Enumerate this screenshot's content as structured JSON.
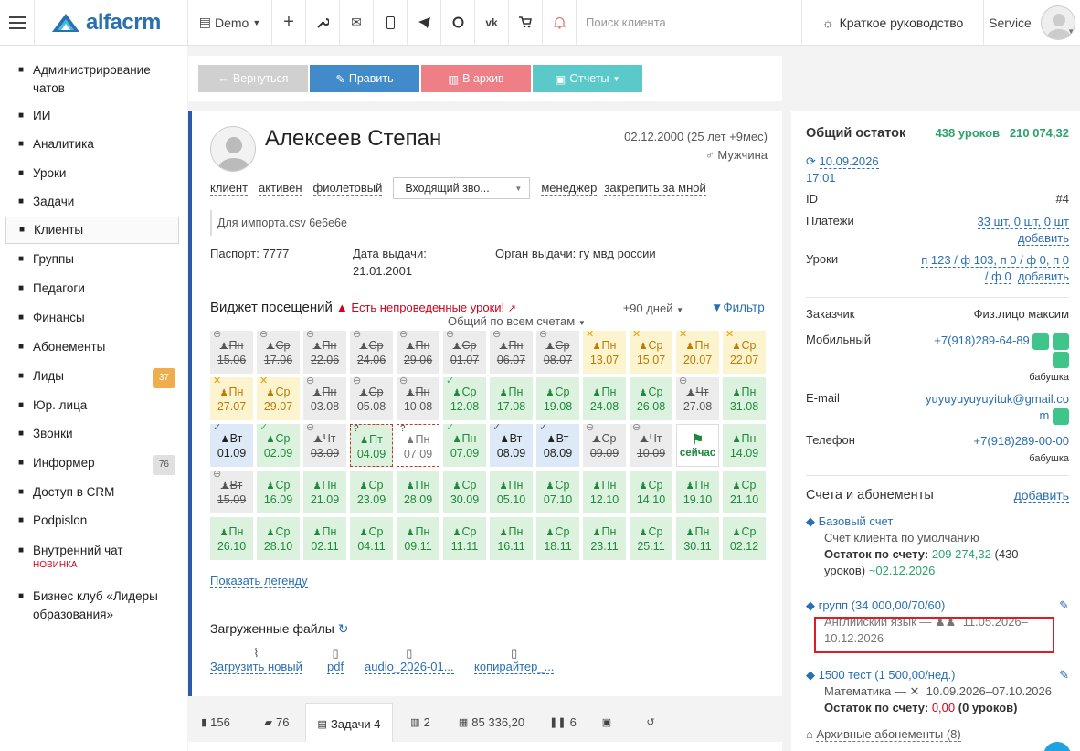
{
  "topbar": {
    "logo_text": "alfacrm",
    "demo_label": "Demo",
    "search_placeholder": "Поиск клиента",
    "guide_label": "Краткое руководство",
    "user_label": "Service",
    "icons": [
      "plus-icon",
      "wrench-icon",
      "envelope-icon",
      "mobile-icon",
      "telegram-icon",
      "whatsapp-icon",
      "vk-icon",
      "cart-icon",
      "bell-icon"
    ]
  },
  "sidebar": {
    "items": [
      {
        "label": "Администрирование чатов",
        "icon": "person-icon"
      },
      {
        "label": "ИИ",
        "icon": "sparkle-icon"
      },
      {
        "label": "Аналитика",
        "icon": "map-icon"
      },
      {
        "label": "Уроки",
        "icon": "calendar-icon"
      },
      {
        "label": "Задачи",
        "icon": "tasks-icon"
      },
      {
        "label": "Клиенты",
        "icon": "person-icon"
      },
      {
        "label": "Группы",
        "icon": "group-icon"
      },
      {
        "label": "Педагоги",
        "icon": "graduation-icon"
      },
      {
        "label": "Финансы",
        "icon": "money-icon"
      },
      {
        "label": "Абонементы",
        "icon": "tag-icon"
      },
      {
        "label": "Лиды",
        "icon": "person-icon",
        "badge": "37",
        "badge_color": "#f0ad4e"
      },
      {
        "label": "Юр. лица",
        "icon": "briefcase-icon"
      },
      {
        "label": "Звонки",
        "icon": "phone-icon"
      },
      {
        "label": "Информер",
        "icon": "person-icon",
        "badge": "76",
        "badge_color": "#e0e0e0"
      },
      {
        "label": "Доступ в CRM",
        "icon": "lock-icon"
      },
      {
        "label": "Podpislon",
        "icon": "document-icon"
      },
      {
        "label": "Внутренний чат",
        "icon": "envelope-icon",
        "tag": "НОВИНКА"
      },
      {
        "label": "Бизнес клуб «Лидеры образования»",
        "icon": "star-icon"
      }
    ]
  },
  "actions": {
    "back": "Вернуться",
    "edit": "Править",
    "archive": "В архив",
    "reports": "Отчеты"
  },
  "client": {
    "name": "Алексеев Степан",
    "dob": "02.12.2000 (25 лет +9мес)",
    "gender": "Мужчина",
    "tags": [
      "клиент",
      "активен",
      "фиолетовый"
    ],
    "select_value": "Входящий зво...",
    "manager": "менеджер",
    "pin": "закрепить за мной",
    "note": "Для импорта.csv 6e6e6e",
    "passport_label": "Паспорт:",
    "passport_value": "7777",
    "issue_date_label": "Дата выдачи:",
    "issue_date_value": "21.01.2001",
    "issuer_label": "Орган выдачи:",
    "issuer_value": "гу мвд россии"
  },
  "widget": {
    "title": "Виджет посещений",
    "warning": "Есть непроведенные уроки!",
    "days": "±90 дней",
    "filter": "Фильтр",
    "common": "Общий по всем счетам",
    "show_legend": "Показать легенду",
    "cells": [
      [
        {
          "d1": "Пн",
          "d2": "15.06",
          "st": "gray",
          "mk": "minus"
        },
        {
          "d1": "Ср",
          "d2": "17.06",
          "st": "gray",
          "mk": "minus"
        },
        {
          "d1": "Пн",
          "d2": "22.06",
          "st": "gray",
          "mk": "minus"
        },
        {
          "d1": "Ср",
          "d2": "24.06",
          "st": "gray",
          "mk": "minus"
        },
        {
          "d1": "Пн",
          "d2": "29.06",
          "st": "gray",
          "mk": "minus"
        },
        {
          "d1": "Ср",
          "d2": "01.07",
          "st": "gray",
          "mk": "minus"
        },
        {
          "d1": "Пн",
          "d2": "06.07",
          "st": "gray",
          "mk": "minus"
        },
        {
          "d1": "Ср",
          "d2": "08.07",
          "st": "gray",
          "mk": "minus"
        },
        {
          "d1": "Пн",
          "d2": "13.07",
          "st": "yellow",
          "mk": "x"
        },
        {
          "d1": "Ср",
          "d2": "15.07",
          "st": "yellow",
          "mk": "x"
        },
        {
          "d1": "Пн",
          "d2": "20.07",
          "st": "yellow",
          "mk": "x"
        },
        {
          "d1": "Ср",
          "d2": "22.07",
          "st": "yellow",
          "mk": "x"
        }
      ],
      [
        {
          "d1": "Пн",
          "d2": "27.07",
          "st": "yellow",
          "mk": "x"
        },
        {
          "d1": "Ср",
          "d2": "29.07",
          "st": "yellow",
          "mk": "x"
        },
        {
          "d1": "Пн",
          "d2": "03.08",
          "st": "gray",
          "mk": "minus"
        },
        {
          "d1": "Ср",
          "d2": "05.08",
          "st": "gray",
          "mk": "minus"
        },
        {
          "d1": "Пн",
          "d2": "10.08",
          "st": "gray",
          "mk": "minus"
        },
        {
          "d1": "Ср",
          "d2": "12.08",
          "st": "green",
          "mk": "check-g"
        },
        {
          "d1": "Пн",
          "d2": "17.08",
          "st": "green",
          "mk": ""
        },
        {
          "d1": "Ср",
          "d2": "19.08",
          "st": "green",
          "mk": ""
        },
        {
          "d1": "Пн",
          "d2": "24.08",
          "st": "green",
          "mk": ""
        },
        {
          "d1": "Ср",
          "d2": "26.08",
          "st": "green",
          "mk": ""
        },
        {
          "d1": "Чт",
          "d2": "27.08",
          "st": "gray",
          "mk": "minus"
        },
        {
          "d1": "Пн",
          "d2": "31.08",
          "st": "green",
          "mk": ""
        }
      ],
      [
        {
          "d1": "Вт",
          "d2": "01.09",
          "st": "blue",
          "mk": "check-d"
        },
        {
          "d1": "Ср",
          "d2": "02.09",
          "st": "green",
          "mk": "check-g"
        },
        {
          "d1": "Чт",
          "d2": "03.09",
          "st": "gray",
          "mk": "minus"
        },
        {
          "d1": "Пт",
          "d2": "04.09",
          "st": "dash-green",
          "mk": "q"
        },
        {
          "d1": "Пн",
          "d2": "07.09",
          "st": "dash-white",
          "mk": "q"
        },
        {
          "d1": "Пн",
          "d2": "07.09",
          "st": "green",
          "mk": "check-g"
        },
        {
          "d1": "Вт",
          "d2": "08.09",
          "st": "blue",
          "mk": "check-d"
        },
        {
          "d1": "Вт",
          "d2": "08.09",
          "st": "blue",
          "mk": "check-d"
        },
        {
          "d1": "Ср",
          "d2": "09.09",
          "st": "gray",
          "mk": "minus"
        },
        {
          "d1": "Чт",
          "d2": "10.09",
          "st": "gray",
          "mk": "minus"
        },
        {
          "d1": "",
          "d2": "сейчас",
          "st": "now",
          "mk": ""
        },
        {
          "d1": "Пн",
          "d2": "14.09",
          "st": "green",
          "mk": ""
        }
      ],
      [
        {
          "d1": "Вт",
          "d2": "15.09",
          "st": "gray",
          "mk": "minus"
        },
        {
          "d1": "Ср",
          "d2": "16.09",
          "st": "green",
          "mk": ""
        },
        {
          "d1": "Пн",
          "d2": "21.09",
          "st": "green",
          "mk": ""
        },
        {
          "d1": "Ср",
          "d2": "23.09",
          "st": "green",
          "mk": ""
        },
        {
          "d1": "Пн",
          "d2": "28.09",
          "st": "green",
          "mk": ""
        },
        {
          "d1": "Ср",
          "d2": "30.09",
          "st": "green",
          "mk": ""
        },
        {
          "d1": "Пн",
          "d2": "05.10",
          "st": "green",
          "mk": ""
        },
        {
          "d1": "Ср",
          "d2": "07.10",
          "st": "green",
          "mk": ""
        },
        {
          "d1": "Пн",
          "d2": "12.10",
          "st": "green",
          "mk": ""
        },
        {
          "d1": "Ср",
          "d2": "14.10",
          "st": "green",
          "mk": ""
        },
        {
          "d1": "Пн",
          "d2": "19.10",
          "st": "green",
          "mk": ""
        },
        {
          "d1": "Ср",
          "d2": "21.10",
          "st": "green",
          "mk": ""
        }
      ],
      [
        {
          "d1": "Пн",
          "d2": "26.10",
          "st": "green",
          "mk": ""
        },
        {
          "d1": "Ср",
          "d2": "28.10",
          "st": "green",
          "mk": ""
        },
        {
          "d1": "Пн",
          "d2": "02.11",
          "st": "green",
          "mk": ""
        },
        {
          "d1": "Ср",
          "d2": "04.11",
          "st": "green",
          "mk": ""
        },
        {
          "d1": "Пн",
          "d2": "09.11",
          "st": "green",
          "mk": ""
        },
        {
          "d1": "Ср",
          "d2": "11.11",
          "st": "green",
          "mk": ""
        },
        {
          "d1": "Пн",
          "d2": "16.11",
          "st": "green",
          "mk": ""
        },
        {
          "d1": "Ср",
          "d2": "18.11",
          "st": "green",
          "mk": ""
        },
        {
          "d1": "Пн",
          "d2": "23.11",
          "st": "green",
          "mk": ""
        },
        {
          "d1": "Ср",
          "d2": "25.11",
          "st": "green",
          "mk": ""
        },
        {
          "d1": "Пн",
          "d2": "30.11",
          "st": "green",
          "mk": ""
        },
        {
          "d1": "Ср",
          "d2": "02.12",
          "st": "green",
          "mk": ""
        }
      ]
    ]
  },
  "files": {
    "title": "Загруженные файлы",
    "items": [
      "Загрузить новый",
      "pdf",
      "audio_2026-01...",
      "копирайтер_..."
    ]
  },
  "tabs": [
    {
      "icon": "book-icon",
      "label": "156"
    },
    {
      "icon": "comments-icon",
      "label": "76"
    },
    {
      "icon": "tasks-icon",
      "label": "Задачи 4"
    },
    {
      "icon": "chart-icon",
      "label": "2"
    },
    {
      "icon": "gift-icon",
      "label": "85 336,20"
    },
    {
      "icon": "pause-icon",
      "label": "6"
    },
    {
      "icon": "money-icon",
      "label": ""
    },
    {
      "icon": "history-icon",
      "label": ""
    }
  ],
  "right": {
    "balance_title": "Общий остаток",
    "balance_lessons": "438 уроков",
    "balance_sum": "210 074,32",
    "sync_date": "10.09.2026",
    "sync_time": "17:01",
    "id_label": "ID",
    "id_value": "#4",
    "payments_label": "Платежи",
    "payments_value": "33 шт, 0 шт, 0 шт",
    "add": "добавить",
    "lessons_label": "Уроки",
    "lessons_value_1": "п 123 / ф 103, п 0 / ф 0, п 0",
    "lessons_value_2": "/ ф 0",
    "customer_label": "Заказчик",
    "customer_value": "Физ.лицо максим",
    "mobile_label": "Мобильный",
    "mobile_value": "+7(918)289-64-89",
    "mobile_note": "бабушка",
    "email_label": "E-mail",
    "email_value_1": "yuyuyuyuyuyituk@gmail.co",
    "email_value_2": "m",
    "phone_label": "Телефон",
    "phone_value": "+7(918)289-00-00",
    "phone_note": "бабушка",
    "accounts_title": "Счета и абонементы",
    "accounts_add": "добавить",
    "base_account": "Базовый счет",
    "base_desc": "Счет клиента по умолчанию",
    "base_rest_label": "Остаток по счету:",
    "base_rest_value": "209 274,32",
    "base_rest_lessons": "(430",
    "base_rest_lessons_2": "уроков)",
    "base_rest_date": "~02.12.2026",
    "sub1_title": "групп (34 000,00/70/60)",
    "sub1_desc": "Английский язык —",
    "sub1_dates_1": "11.05.2026–",
    "sub1_dates_2": "10.12.2026",
    "sub2_title": "1500 тест (1 500,00/нед.)",
    "sub2_desc": "Математика —",
    "sub2_dates": "10.09.2026–07.10.2026",
    "sub2_rest_label": "Остаток по счету:",
    "sub2_rest_value": "0,00",
    "sub2_rest_lessons": "(0 уроков)",
    "archive_subs": "Архивные абонементы (8)"
  }
}
